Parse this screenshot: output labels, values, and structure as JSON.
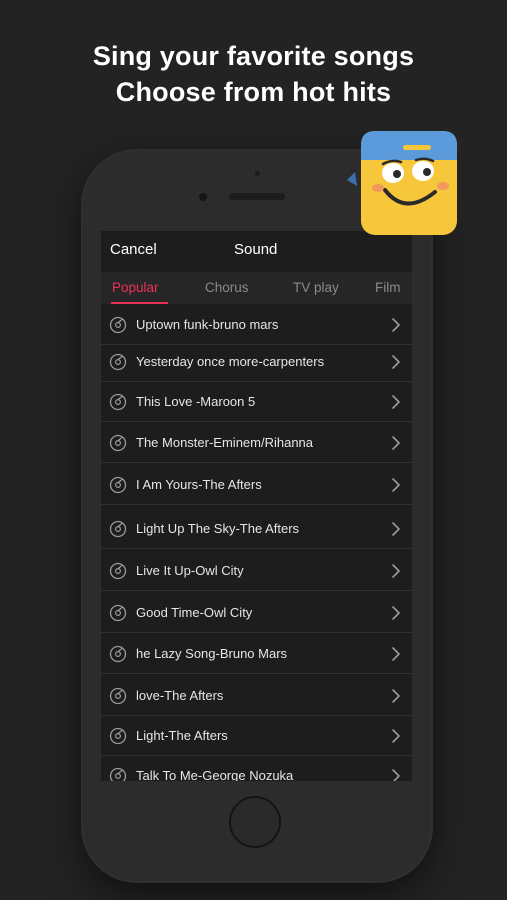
{
  "headline": {
    "line1": "Sing your favorite songs",
    "line2": "Choose from hot hits"
  },
  "nav": {
    "cancel": "Cancel",
    "title": "Sound"
  },
  "tabs": [
    {
      "label": "Popular",
      "active": true
    },
    {
      "label": "Chorus",
      "active": false
    },
    {
      "label": "TV play",
      "active": false
    },
    {
      "label": "Film",
      "active": false
    }
  ],
  "songs": [
    "Uptown funk-bruno mars",
    "Yesterday once more-carpenters",
    "This Love -Maroon 5",
    "The Monster-Eminem/Rihanna",
    "I Am Yours-The Afters",
    "Light Up The Sky-The Afters",
    "Live It Up-Owl City",
    "Good Time-Owl City",
    "he Lazy Song-Bruno Mars",
    "love-The Afters",
    "Light-The Afters",
    "Talk To Me-George Nozuka"
  ],
  "icons": {
    "row_icon": "music-disc-icon",
    "row_chevron": "chevron-right-icon",
    "mascot": "mascot-face-icon"
  },
  "colors": {
    "accent": "#e8325a",
    "background": "#232323",
    "screen": "#1d1d1d",
    "mascot_yellow": "#f6c73a",
    "mascot_blue": "#5b9bdc"
  }
}
